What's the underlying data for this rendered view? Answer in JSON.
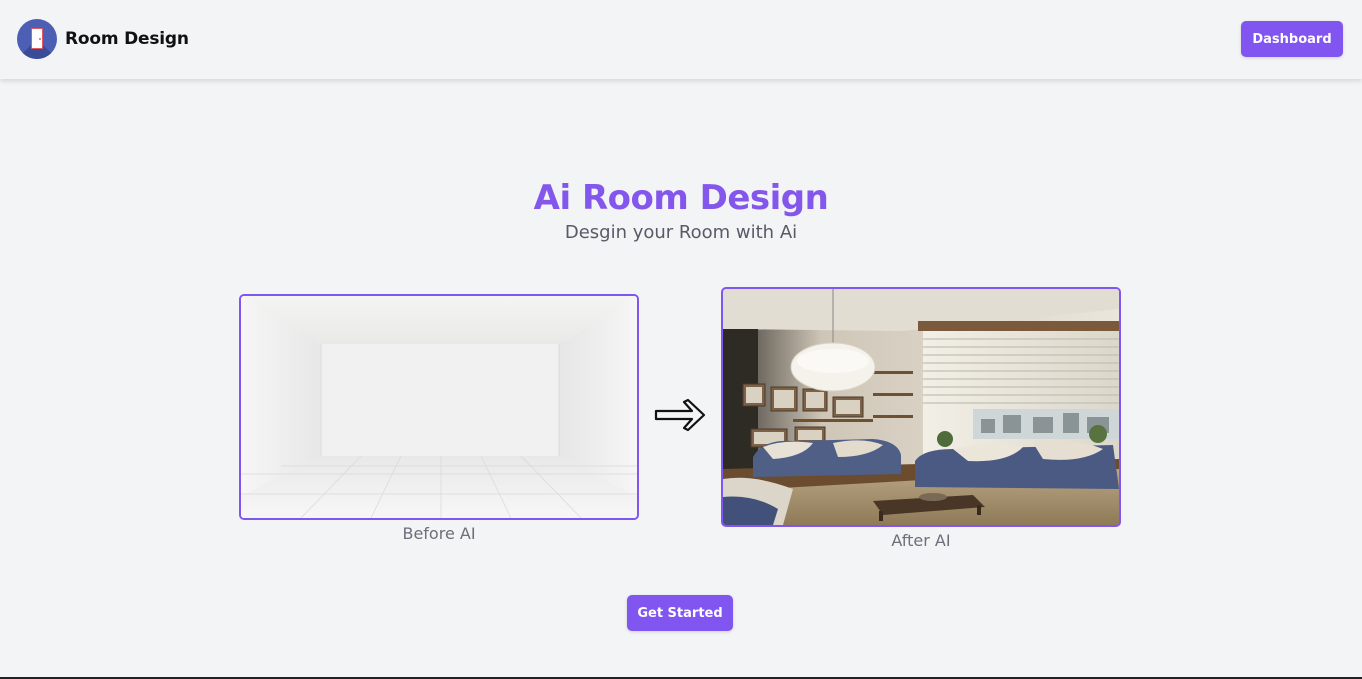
{
  "header": {
    "brand": "Room Design",
    "logo_icon": "door-icon",
    "dashboard_label": "Dashboard"
  },
  "hero": {
    "title": "Ai Room Design",
    "subtitle": "Desgin your Room with Ai"
  },
  "comparison": {
    "before_caption": "Before AI",
    "after_caption": "After AI",
    "arrow_icon": "right-arrow-icon"
  },
  "cta": {
    "label": "Get Started"
  },
  "colors": {
    "accent": "#8055f0",
    "title": "#8457ec",
    "background": "#f3f4f6"
  }
}
